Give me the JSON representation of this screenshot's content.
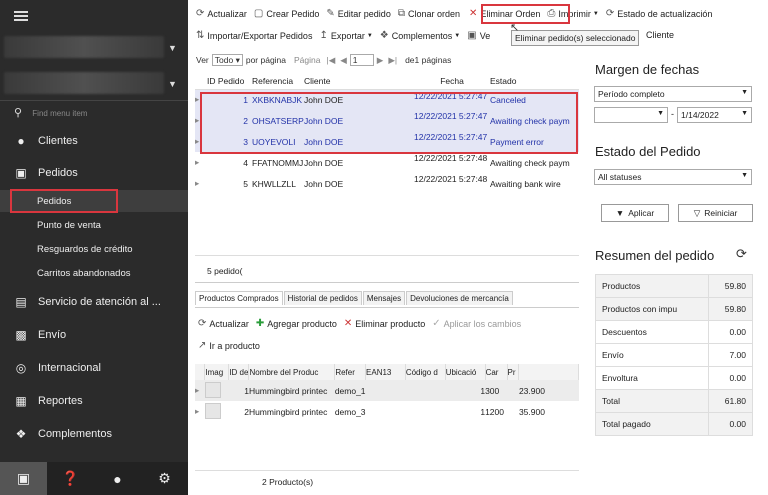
{
  "sidebar": {
    "search_placeholder": "Find menu item",
    "items": [
      {
        "label": "Clientes"
      },
      {
        "label": "Pedidos"
      },
      {
        "label": "Servicio de atención al ..."
      },
      {
        "label": "Envío"
      },
      {
        "label": "Internacional"
      },
      {
        "label": "Reportes"
      },
      {
        "label": "Complementos"
      }
    ],
    "subitems": [
      {
        "label": "Pedidos"
      },
      {
        "label": "Punto de venta"
      },
      {
        "label": "Resguardos de crédito"
      },
      {
        "label": "Carritos abandonados"
      }
    ]
  },
  "toolbar": {
    "row1": [
      "Actualizar",
      "Crear Pedido",
      "Editar pedido",
      "Clonar orden",
      "Eliminar Orden",
      "Imprimir",
      "Estado de actualización"
    ],
    "row2": [
      "Importar/Exportar Pedidos",
      "Exportar",
      "Complementos",
      "Ve",
      "Cliente"
    ],
    "tooltip": "Eliminar pedido(s) seleccionado"
  },
  "pager": {
    "ver": "Ver",
    "per_page_value": "Todo",
    "por_pagina": "por página",
    "pagina": "Página",
    "page": "1",
    "of_pages": "de1 páginas"
  },
  "orders": {
    "columns": [
      "ID Pedido",
      "Referencia",
      "Cliente",
      "Fecha",
      "Estado"
    ],
    "rows": [
      {
        "id": "1",
        "ref": "XKBKNABJK",
        "client": "John DOE",
        "date": "12/22/2021 5:27:47",
        "status": "Canceled"
      },
      {
        "id": "2",
        "ref": "OHSATSERP",
        "client": "John DOE",
        "date": "12/22/2021 5:27:47",
        "status": "Awaiting check paym"
      },
      {
        "id": "3",
        "ref": "UOYEVOLI",
        "client": "John DOE",
        "date": "12/22/2021 5:27:47",
        "status": "Payment error"
      },
      {
        "id": "4",
        "ref": "FFATNOMMJ",
        "client": "John DOE",
        "date": "12/22/2021 5:27:48",
        "status": "Awaiting check paym"
      },
      {
        "id": "5",
        "ref": "KHWLLZLL",
        "client": "John DOE",
        "date": "12/22/2021 5:27:48",
        "status": "Awaiting bank wire"
      }
    ],
    "count": "5 pedido("
  },
  "tabs": [
    "Productos Comprados",
    "Historial de pedidos",
    "Mensajes",
    "Devoluciones de mercancía"
  ],
  "products_toolbar": [
    "Actualizar",
    "Agregar producto",
    "Eliminar producto",
    "Aplicar los cambios",
    "Ir a producto"
  ],
  "products": {
    "columns": [
      "Imag",
      "ID de",
      "Nombre del Produc",
      "Refer",
      "EAN13",
      "Código d",
      "Ubicació",
      "Car",
      "Pr"
    ],
    "rows": [
      {
        "id": "1",
        "name": "Hummingbird printec",
        "ref": "demo_1",
        "qty": "1",
        "price": "300",
        "total": "23.900"
      },
      {
        "id": "2",
        "name": "Hummingbird printec",
        "ref": "demo_3",
        "qty": "1",
        "price": "1200",
        "total": "35.900"
      }
    ],
    "count": "2 Producto(s)"
  },
  "right": {
    "date_title": "Margen de fechas",
    "period": "Período completo",
    "date_to": "1/14/2022",
    "status_title": "Estado del Pedido",
    "status_value": "All statuses",
    "apply": "Aplicar",
    "reset": "Reiniciar",
    "summary_title": "Resumen del pedido",
    "summary": [
      {
        "label": "Productos",
        "value": "59.80"
      },
      {
        "label": "Productos con impu",
        "value": "59.80"
      },
      {
        "label": "Descuentos",
        "value": "0.00"
      },
      {
        "label": "Envío",
        "value": "7.00"
      },
      {
        "label": "Envoltura",
        "value": "0.00"
      },
      {
        "label": "Total",
        "value": "61.80"
      },
      {
        "label": "Total pagado",
        "value": "0.00"
      }
    ]
  }
}
